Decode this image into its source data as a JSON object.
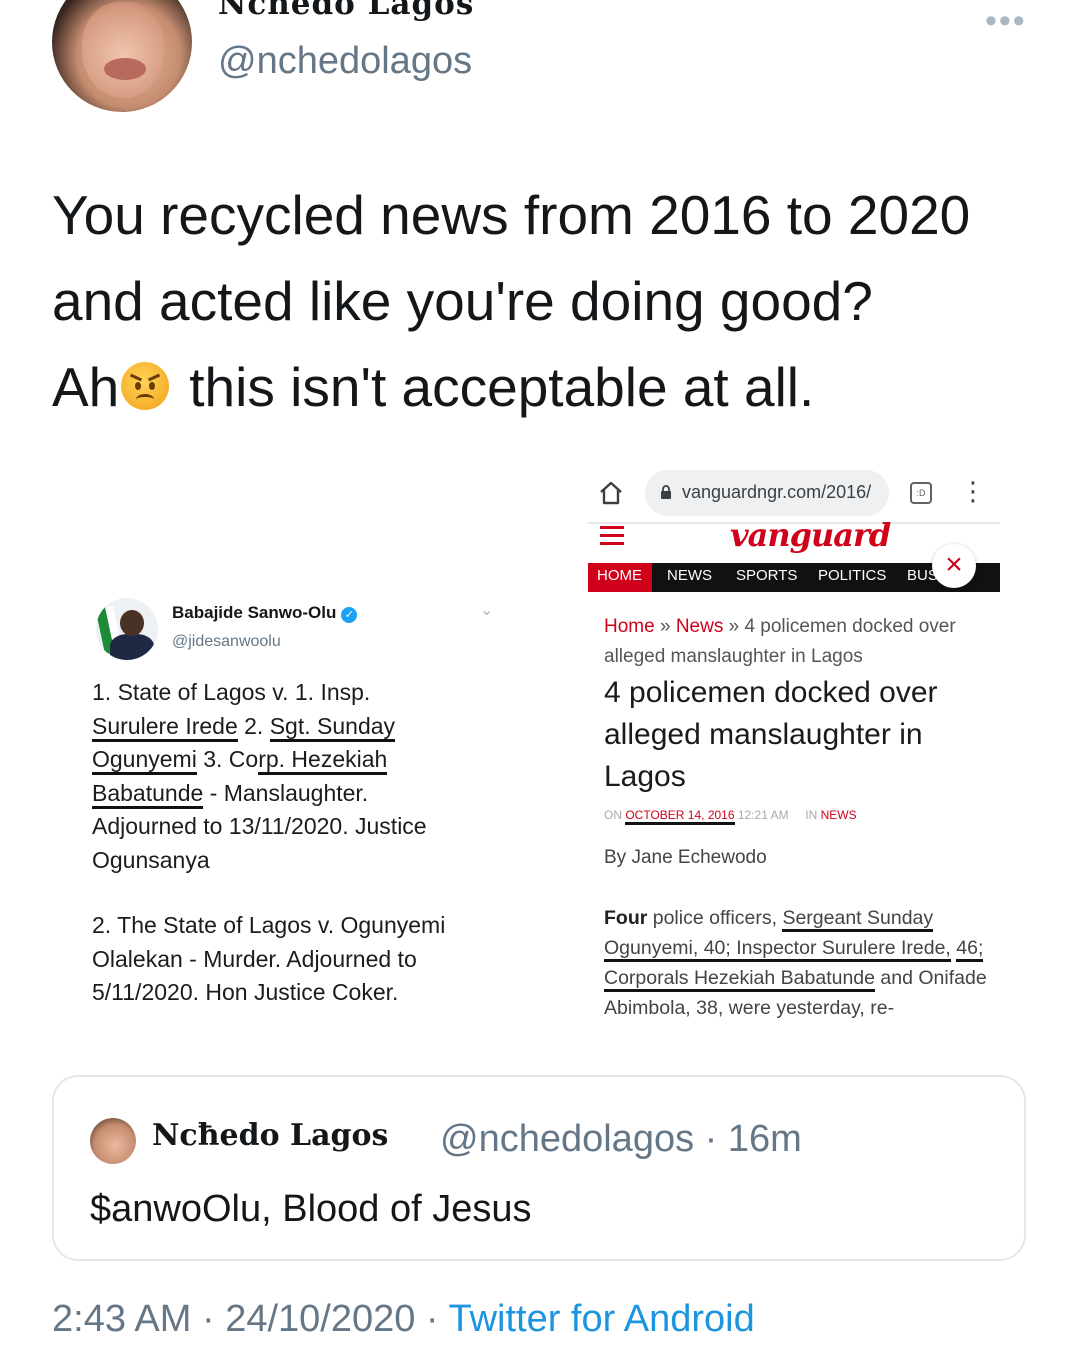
{
  "author": {
    "display_name": "Ncħedo Lagos",
    "handle": "@nchedolagos"
  },
  "tweet": {
    "line1": "You recycled news from 2016 to 2020",
    "line2": "and acted like you're doing good?",
    "line3_prefix": "Ah",
    "line3_suffix": "this isn't acceptable at all."
  },
  "embedded_tweet": {
    "name": "Babajide Sanwo-Olu",
    "handle": "@jidesanwoolu",
    "item1": {
      "a": "1. State of Lagos v. 1. Insp.",
      "b": "Surulere Irede",
      "c": " 2. ",
      "d": "Sgt. Sunday",
      "e": "Ogunyemi",
      "f": " 3. Co",
      "g": "rp. Hezekiah",
      "h": "Babatunde",
      "i": " - Manslaughter.",
      "j": "Adjourned to 13/11/2020. Justice",
      "k": "Ogunsanya"
    },
    "item2": "2. The State of Lagos v. Ogunyemi\nOlalekan - Murder. Adjourned to\n5/11/2020. Hon Justice Coker."
  },
  "news_screenshot": {
    "url": "vanguardngr.com/2016/",
    "brand": "vanguard",
    "nav": [
      "HOME",
      "NEWS",
      "SPORTS",
      "POLITICS",
      "BUS"
    ],
    "breadcrumb_home": "Home",
    "breadcrumb_sep": " » ",
    "breadcrumb_news": "News",
    "breadcrumb_rest": " » 4 policemen docked over alleged manslaughter in Lagos",
    "headline": "4 policemen docked over alleged manslaughter in Lagos",
    "meta_on": "ON ",
    "meta_date": "OCTOBER 14, 2016",
    "meta_time": "12:21 AM",
    "meta_in": "IN ",
    "meta_cat": "NEWS",
    "byline": "By Jane Echewodo",
    "body_bold": "Four",
    "body_a": " police officers, ",
    "body_b": "Sergeant Sunday",
    "body_c": "Ogunyemi, 40; ",
    "body_d": "Inspector Surulere Irede,",
    "body_e": "46; Corporals Hezekiah Babatunde",
    "body_f": " and Onifade Abimbola, 38, were yesterday, re-"
  },
  "quoted_tweet": {
    "display_name": "Ncħedo Lagos",
    "handle_time": "@nchedolagos · 16m",
    "text": "$anwoOlu, Blood of Jesus"
  },
  "footer": {
    "time": "2:43 AM · 24/10/2020 · ",
    "source": "Twitter for Android"
  },
  "colors": {
    "link_blue": "#1b95e0",
    "vanguard_red": "#d0021b",
    "secondary_text": "#657786"
  }
}
